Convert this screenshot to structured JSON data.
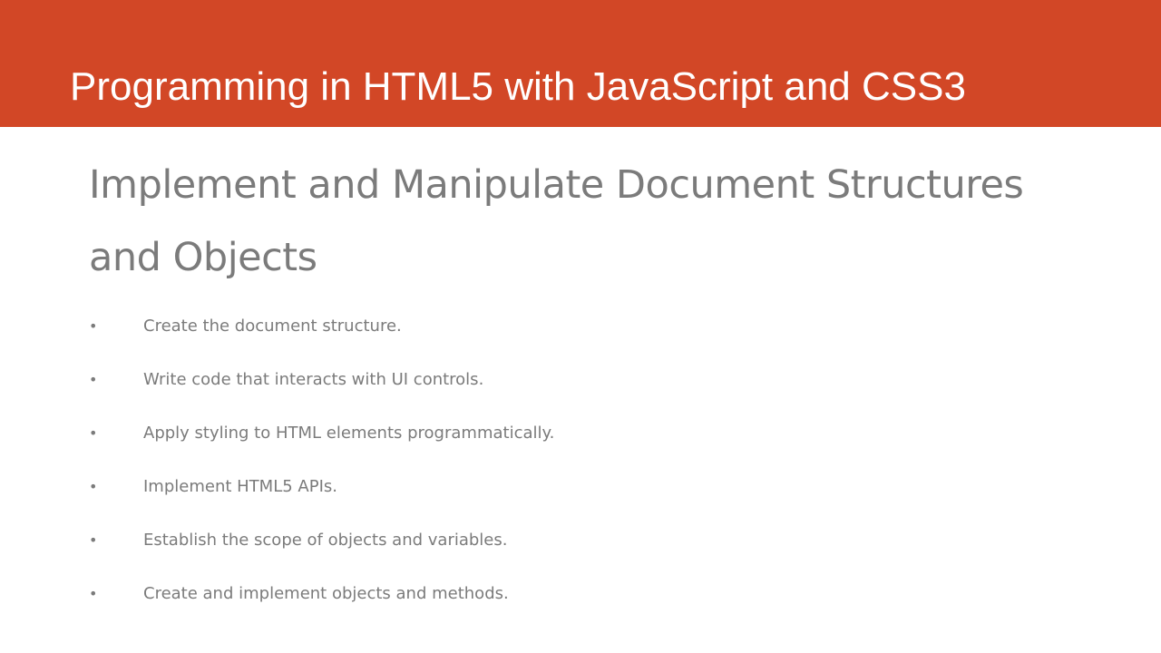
{
  "slide": {
    "header": {
      "title": "Programming in HTML5 with JavaScript and CSS3",
      "background_color": "#d24726",
      "text_color": "#ffffff"
    },
    "section_title": "Implement and Manipulate Document Structures and Objects",
    "text_color": "#7b7b7b",
    "bullet_symbol": "•",
    "bullets": [
      "Create the document structure.",
      "Write code that interacts with UI controls.",
      "Apply styling to HTML elements programmatically.",
      "Implement HTML5 APIs.",
      "Establish the scope of objects and variables.",
      "Create and implement objects and methods."
    ]
  }
}
